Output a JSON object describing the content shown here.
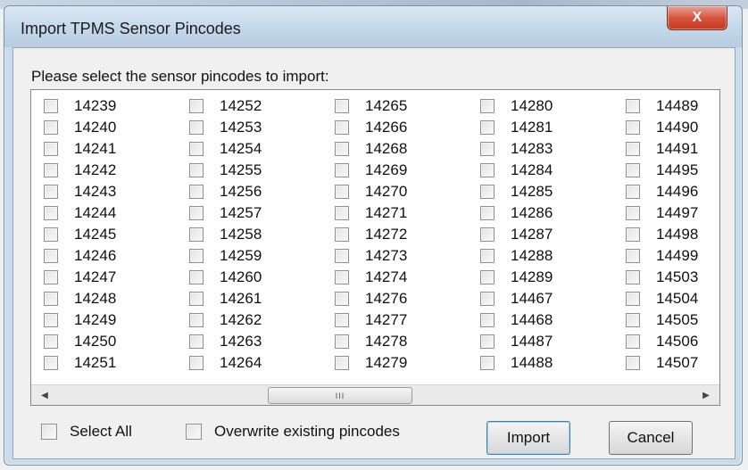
{
  "window": {
    "title": "Import TPMS Sensor Pincodes",
    "close_symbol": "X"
  },
  "prompt": "Please select the sensor pincodes to import:",
  "pincode_columns": [
    [
      "14239",
      "14240",
      "14241",
      "14242",
      "14243",
      "14244",
      "14245",
      "14246",
      "14247",
      "14248",
      "14249",
      "14250",
      "14251"
    ],
    [
      "14252",
      "14253",
      "14254",
      "14255",
      "14256",
      "14257",
      "14258",
      "14259",
      "14260",
      "14261",
      "14262",
      "14263",
      "14264"
    ],
    [
      "14265",
      "14266",
      "14268",
      "14269",
      "14270",
      "14271",
      "14272",
      "14273",
      "14274",
      "14276",
      "14277",
      "14278",
      "14279"
    ],
    [
      "14280",
      "14281",
      "14283",
      "14284",
      "14285",
      "14286",
      "14287",
      "14288",
      "14289",
      "14467",
      "14468",
      "14487",
      "14488"
    ],
    [
      "14489",
      "14490",
      "14491",
      "14495",
      "14496",
      "14497",
      "14498",
      "14499",
      "14503",
      "14504",
      "14505",
      "14506",
      "14507"
    ]
  ],
  "scrollbar": {
    "left_arrow": "◀",
    "right_arrow": "▶",
    "thumb_grip": "III"
  },
  "options": {
    "select_all_label": "Select All",
    "overwrite_label": "Overwrite existing pincodes"
  },
  "buttons": {
    "import_label": "Import",
    "cancel_label": "Cancel"
  }
}
